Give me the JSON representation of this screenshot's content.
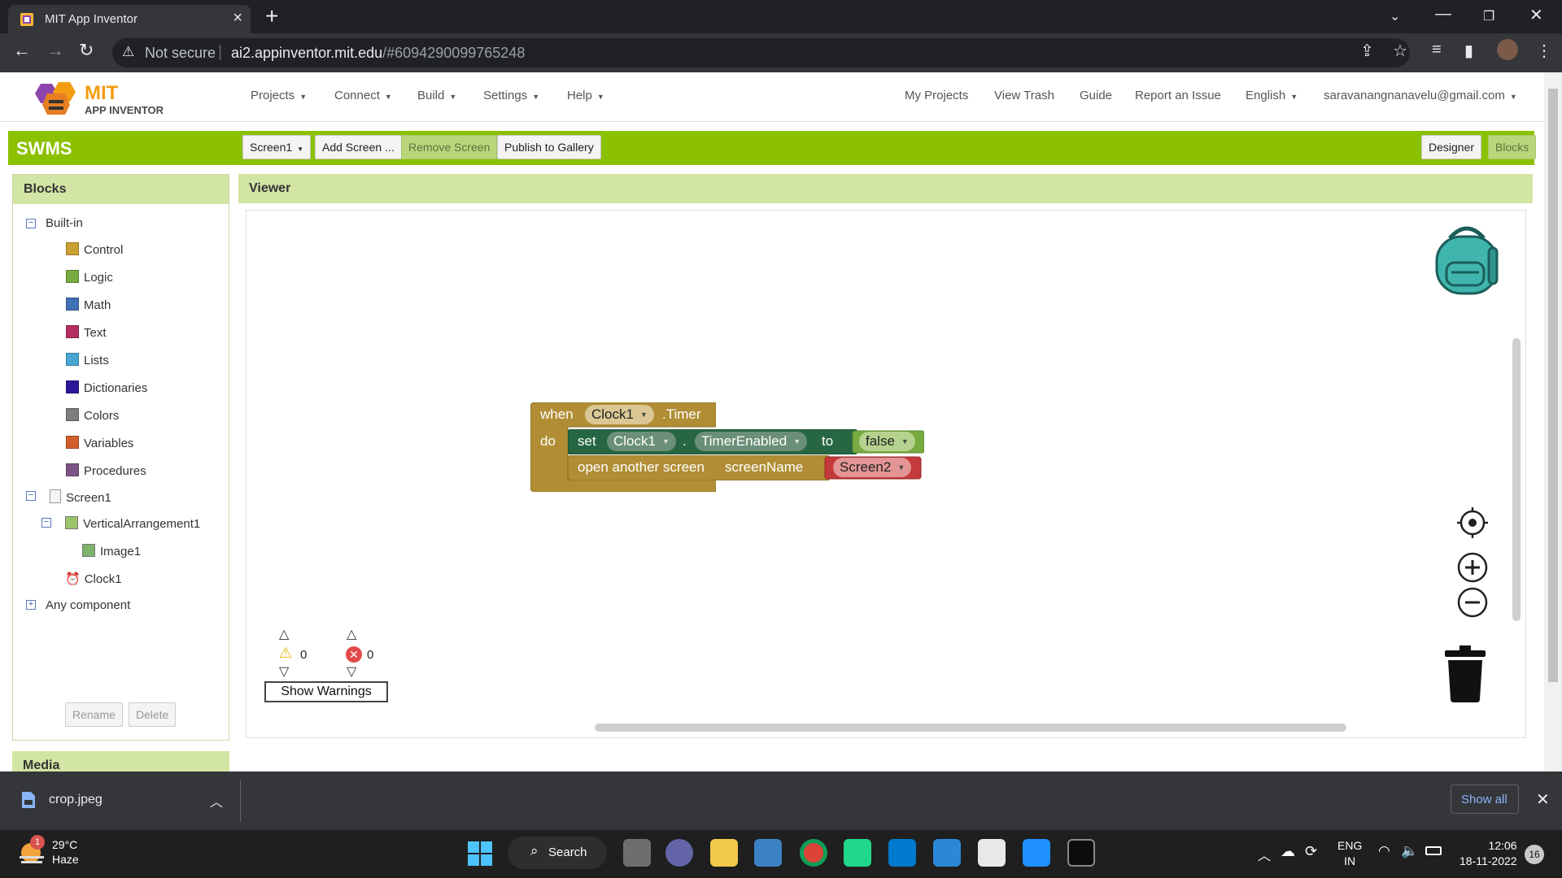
{
  "browser": {
    "tab_title": "MIT App Inventor",
    "security": "Not secure",
    "url_host": "ai2.appinventor.mit.edu",
    "url_path": "/#6094290099765248"
  },
  "app": {
    "logo_mit": "MIT",
    "logo_sub": "APP INVENTOR",
    "menu": [
      "Projects",
      "Connect",
      "Build",
      "Settings",
      "Help"
    ],
    "right_menu": [
      "My Projects",
      "View Trash",
      "Guide",
      "Report an Issue"
    ],
    "language": "English",
    "account": "saravanangnanavelu@gmail.com"
  },
  "project": {
    "name": "SWMS",
    "screen_select": "Screen1",
    "add_screen": "Add Screen ...",
    "remove_screen": "Remove Screen",
    "publish": "Publish to Gallery",
    "designer": "Designer",
    "blocks": "Blocks"
  },
  "blocks_panel": {
    "title": "Blocks",
    "builtin": "Built-in",
    "categories": [
      {
        "label": "Control",
        "color": "#c9a032"
      },
      {
        "label": "Logic",
        "color": "#77ab41"
      },
      {
        "label": "Math",
        "color": "#3f71b5"
      },
      {
        "label": "Text",
        "color": "#b32d5e"
      },
      {
        "label": "Lists",
        "color": "#49a6d4"
      },
      {
        "label": "Dictionaries",
        "color": "#2d1799"
      },
      {
        "label": "Colors",
        "color": "#7d7d7d"
      },
      {
        "label": "Variables",
        "color": "#d05f2d"
      },
      {
        "label": "Procedures",
        "color": "#7c5385"
      }
    ],
    "screen": "Screen1",
    "arrangement": "VerticalArrangement1",
    "image": "Image1",
    "clock": "Clock1",
    "any_component": "Any component",
    "rename": "Rename",
    "delete": "Delete",
    "media": "Media"
  },
  "viewer": {
    "title": "Viewer",
    "event": {
      "when": "when",
      "component": "Clock1",
      "event_name": ".Timer",
      "do": "do"
    },
    "setter": {
      "set": "set",
      "component": "Clock1",
      "dot": ".",
      "property": "TimerEnabled",
      "to": "to",
      "value": "false"
    },
    "open_screen": {
      "label": "open another screen",
      "param": "screenName",
      "value": "Screen2"
    },
    "warnings_count": "0",
    "errors_count": "0",
    "show_warnings": "Show Warnings"
  },
  "download": {
    "file": "crop.jpeg",
    "show_all": "Show all"
  },
  "taskbar": {
    "temp": "29°C",
    "weather": "Haze",
    "weather_badge": "1",
    "search": "Search",
    "lang1": "ENG",
    "lang2": "IN",
    "time": "12:06",
    "date": "18-11-2022",
    "notifications": "16"
  }
}
